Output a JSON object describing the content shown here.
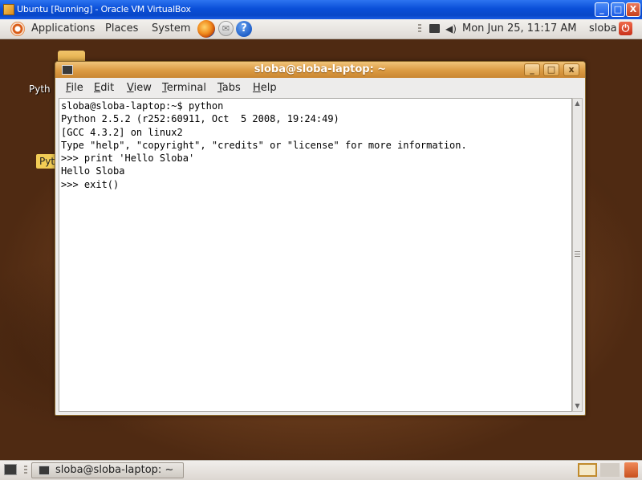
{
  "host_window": {
    "title": "Ubuntu [Running] - Oracle VM VirtualBox",
    "buttons": {
      "minimize": "_",
      "maximize": "□",
      "close": "X"
    }
  },
  "top_panel": {
    "menus": [
      "Applications",
      "Places",
      "System"
    ],
    "clock": "Mon Jun 25, 11:17 AM",
    "user": "sloba",
    "icons": [
      "ubuntu-logo",
      "firefox-icon",
      "mail-icon",
      "help-icon",
      "network-icon",
      "volume-icon",
      "power-icon"
    ]
  },
  "desktop": {
    "labels": [
      "Pyth",
      "Pyt"
    ]
  },
  "terminal": {
    "title": "sloba@sloba-laptop: ~",
    "menu": [
      {
        "ul": "F",
        "rest": "ile"
      },
      {
        "ul": "E",
        "rest": "dit"
      },
      {
        "ul": "V",
        "rest": "iew"
      },
      {
        "ul": "T",
        "rest": "erminal"
      },
      {
        "ul": "T",
        "rest": "abs"
      },
      {
        "ul": "H",
        "rest": "elp"
      }
    ],
    "content": "sloba@sloba-laptop:~$ python\nPython 2.5.2 (r252:60911, Oct  5 2008, 19:24:49)\n[GCC 4.3.2] on linux2\nType \"help\", \"copyright\", \"credits\" or \"license\" for more information.\n>>> print 'Hello Sloba'\nHello Sloba\n>>> exit()",
    "window_buttons": {
      "minimize": "_",
      "maximize": "□",
      "close": "x"
    }
  },
  "bottom_panel": {
    "task": "sloba@sloba-laptop: ~"
  },
  "colors": {
    "xp_blue": "#0a4fd8",
    "term_title": "#db9a42",
    "desktop_brown": "#6e3f1e"
  }
}
